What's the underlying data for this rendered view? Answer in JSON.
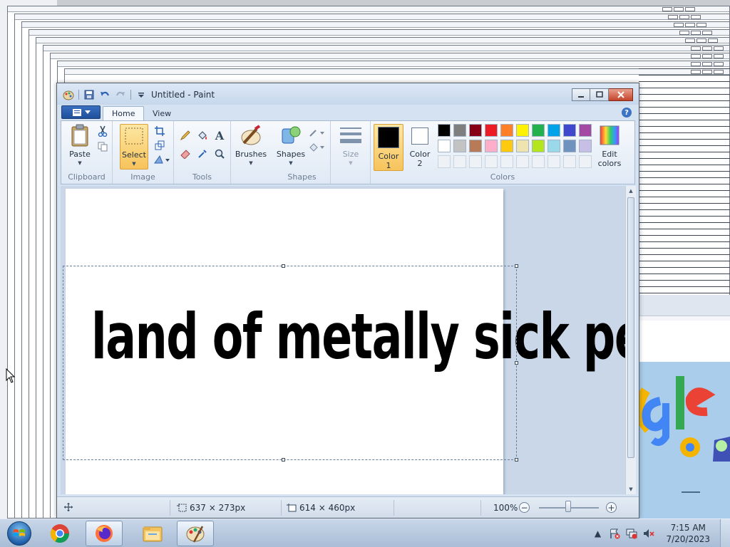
{
  "window": {
    "title": "Untitled - Paint",
    "minimize_label": "",
    "maximize_label": "",
    "close_label": ""
  },
  "tabs": [
    {
      "label": "Home"
    },
    {
      "label": "View"
    }
  ],
  "ribbon": {
    "clipboard": {
      "label": "Clipboard",
      "paste_label": "Paste"
    },
    "image": {
      "label": "Image",
      "select_label": "Select"
    },
    "tools": {
      "label": "Tools"
    },
    "shapes": {
      "label": "Shapes",
      "brushes_label": "Brushes",
      "shapes_label": "Shapes"
    },
    "size": {
      "label": "Size"
    },
    "colors": {
      "label": "Colors",
      "color1_label": "Color",
      "color1_num": "1",
      "color2_label": "Color",
      "color2_num": "2",
      "edit_colors_label": "Edit",
      "edit_colors_label2": "colors",
      "color1_value": "#000000",
      "color2_value": "#ffffff",
      "palette_row1": [
        "#000000",
        "#7f7f7f",
        "#880015",
        "#ed1c24",
        "#ff7f27",
        "#fff200",
        "#22b14c",
        "#00a2e8",
        "#3f48cc",
        "#a349a4"
      ],
      "palette_row2": [
        "#ffffff",
        "#c3c3c3",
        "#b97a57",
        "#ffaec9",
        "#ffc90e",
        "#efe4b0",
        "#b5e61d",
        "#99d9ea",
        "#7092be",
        "#c8bfe7"
      ]
    }
  },
  "canvas": {
    "text": "land of metally sick people"
  },
  "status": {
    "selection_size": "637 × 273px",
    "canvas_size": "614 × 460px",
    "zoom": "100%"
  },
  "taskbar": {
    "time": "7:15 AM",
    "date": "7/20/2023"
  }
}
